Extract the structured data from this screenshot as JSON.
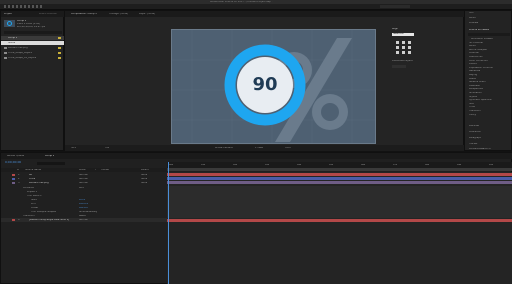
{
  "window": {
    "title": "Adobe After Effects CC 2017 - /Untitled Project.aep *"
  },
  "project": {
    "tab": "Project",
    "tab2": "Effect Controls",
    "comp_name": "Comp 1",
    "comp_info": "1920 x 1080 (1.00)",
    "comp_info2": "Δ 0;00;10;00, 29.97 fps",
    "search_placeholder": "",
    "files": [
      {
        "name": "Comp 1"
      },
      {
        "name": "Solids"
      },
      {
        "name": "Percent-Flat.png"
      },
      {
        "name": "circle_shape_Layers"
      },
      {
        "name": "circle_shape_01_Layers"
      }
    ]
  },
  "viewer": {
    "tabs": [
      "Composition: Comp 1",
      "Footage: (none)",
      "Layer: (none)"
    ],
    "number": "90",
    "toolbar": [
      "50%",
      "Full",
      "Active Camera",
      "1 View",
      "+0.0"
    ]
  },
  "align_panel": {
    "title": "Align",
    "label": "Align Layers to:",
    "value": "Selection",
    "distribute": "Distribute Layers:"
  },
  "right_panel": {
    "tabs": [
      "Info",
      "Audio",
      "Preview",
      "Effects & Presets"
    ],
    "items": [
      "* Animation Presets",
      "3D Channel",
      "Audio",
      "Blur & Sharpen",
      "Channel",
      "CINEMA 4D",
      "Color Correction",
      "Distort",
      "Expression Controls",
      "Generate",
      "Keying",
      "Matte",
      "Noise & Grain",
      "Obsolete",
      "Perspective",
      "Simulation",
      "Stylize",
      "Synthetic Aperture",
      "Text",
      "Time",
      "Transition",
      "Utility"
    ],
    "sections": [
      "Libraries",
      "Character",
      "Paragraph",
      "Tracker",
      "Content-Aware Fill"
    ]
  },
  "timeline": {
    "tabs": [
      "Render Queue",
      "Comp 1"
    ],
    "timecode": "0;00;00;00",
    "col_headers": [
      "#",
      "Source Name",
      "Mode",
      "T",
      "TrkMat",
      "Parent"
    ],
    "layers": [
      {
        "num": "1",
        "name": "90",
        "mode": "Normal",
        "parent": "None"
      },
      {
        "num": "2",
        "name": "circle",
        "mode": "Normal",
        "parent": "None"
      },
      {
        "num": "3",
        "name": "Percent-Flat.png",
        "mode": "Normal",
        "parent": "None"
      }
    ],
    "props": [
      "Contents",
      "Ellipse 1",
      "Trim Paths 1",
      "Start",
      "End",
      "Offset",
      "Trim Multiple Shapes",
      "Transform"
    ],
    "prop_values": [
      "Add:",
      "",
      "",
      "0.0%",
      "100.0%",
      "0x+0.0°",
      "Simultaneously",
      "Reset"
    ],
    "bottom_layer": {
      "num": "4",
      "name": "[Medium Gray-Royal Blue Solid 1]",
      "mode": "Normal"
    },
    "ruler": [
      "00s",
      "01s",
      "02s",
      "03s",
      "04s",
      "05s",
      "06s",
      "07s",
      "08s",
      "09s",
      "10s"
    ]
  },
  "colors": {
    "accent": "#2a8fd6",
    "ring": "#1ea6f0",
    "canvas": "#4e6072",
    "bar_red": "#b34848",
    "bar_blue": "#4b5ca8",
    "bar_purple": "#6f5d86",
    "playhead": "#4a8fd9"
  }
}
